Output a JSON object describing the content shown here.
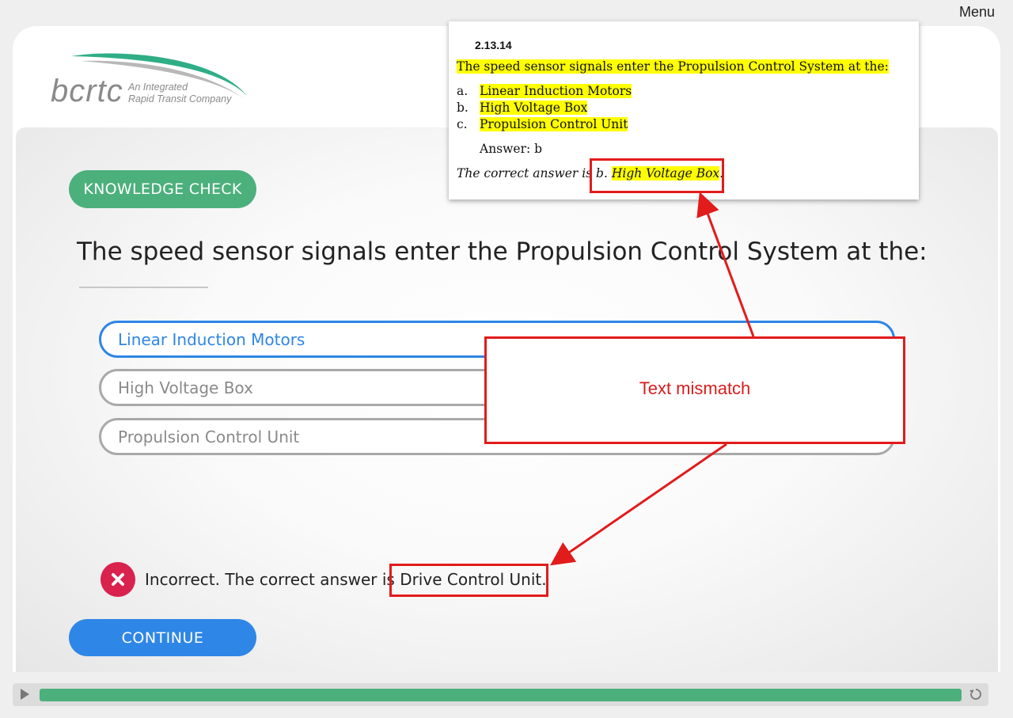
{
  "menu": {
    "label": "Menu"
  },
  "logo": {
    "word": "bcrtc",
    "tagline_line1": "An Integrated",
    "tagline_line2": "Rapid Transit Company"
  },
  "badge": {
    "label": "KNOWLEDGE CHECK"
  },
  "question": {
    "text": "The speed sensor signals enter the Propulsion Control System at the:"
  },
  "options": [
    {
      "label": "Linear Induction Motors",
      "selected": true
    },
    {
      "label": "High Voltage Box",
      "selected": false
    },
    {
      "label": "Propulsion Control Unit",
      "selected": false
    }
  ],
  "feedback": {
    "prefix": "Incorrect. The correct answer is ",
    "answer": "Drive Control Unit."
  },
  "continue": {
    "label": "CONTINUE"
  },
  "player": {
    "progress_fraction": 1.0
  },
  "doc": {
    "number": "2.13.14",
    "question": "The speed sensor signals enter the Propulsion Control System at the:",
    "options": [
      {
        "letter": "a.",
        "text": "Linear Induction Motors"
      },
      {
        "letter": "b.",
        "text": "High Voltage Box"
      },
      {
        "letter": "c.",
        "text": "Propulsion Control Unit"
      }
    ],
    "answer": "Answer: b",
    "correct_prefix": "The correct answer is b. ",
    "correct_answer": "High Voltage Box",
    "correct_suffix": "."
  },
  "annotation": {
    "label": "Text mismatch",
    "color": "#e21b1b"
  },
  "colors": {
    "accent_green": "#4cb07c",
    "accent_blue": "#2e86e6",
    "error_red": "#d9224e",
    "highlight": "#ffff00"
  }
}
